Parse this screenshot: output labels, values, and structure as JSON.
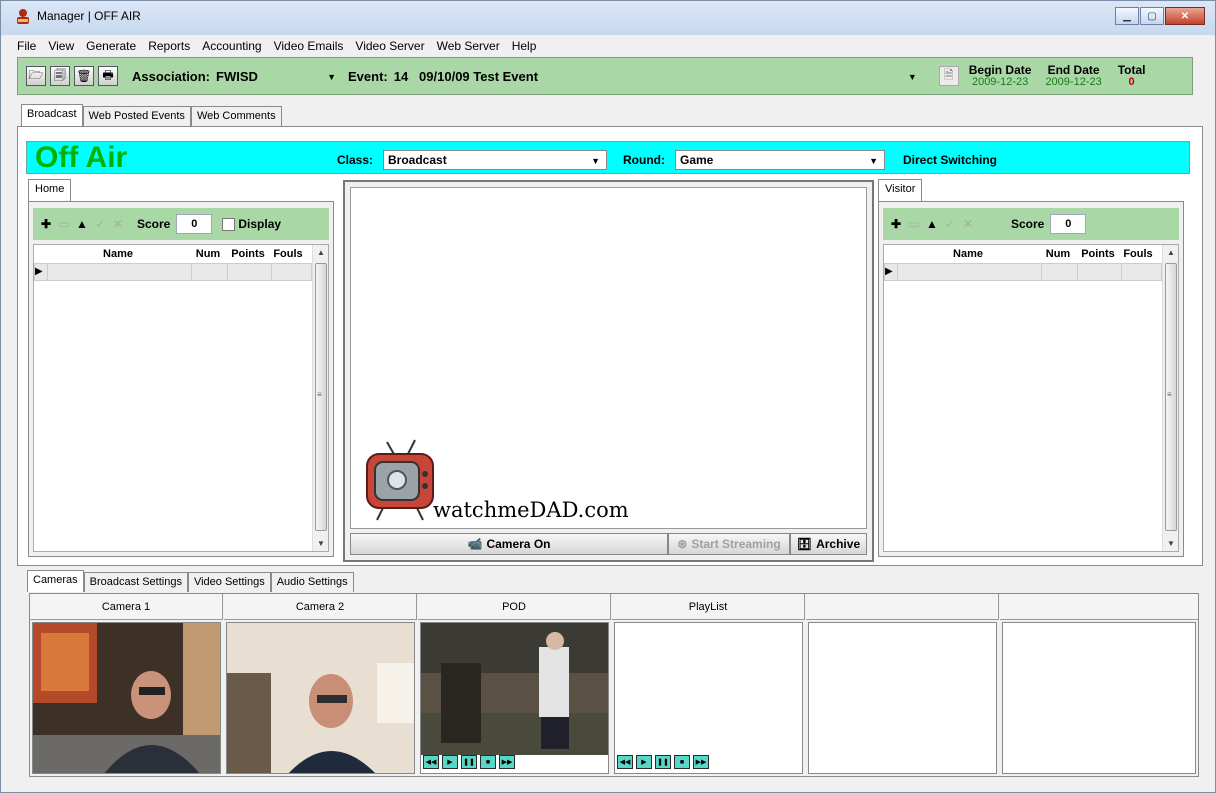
{
  "window": {
    "title": "Manager | OFF AIR",
    "buttons": [
      "minimize",
      "maximize",
      "close"
    ]
  },
  "menu": [
    "File",
    "View",
    "Generate",
    "Reports",
    "Accounting",
    "Video Emails",
    "Video Server",
    "Web Server",
    "Help"
  ],
  "toolbar": {
    "icons": [
      "open-folder-icon",
      "save-icon",
      "delete-icon",
      "print-icon"
    ],
    "association_label": "Association:",
    "association_value": "FWISD",
    "event_label": "Event:",
    "event_value": "14   09/10/09 Test Event",
    "begin_date_label": "Begin Date",
    "begin_date_value": "2009-12-23",
    "end_date_label": "End Date",
    "end_date_value": "2009-12-23",
    "total_label": "Total",
    "total_value": "0"
  },
  "top_tabs": [
    "Broadcast",
    "Web Posted Events",
    "Web Comments"
  ],
  "broadcast": {
    "status": "Off Air",
    "class_label": "Class:",
    "class_value": "Broadcast",
    "round_label": "Round:",
    "round_value": "Game",
    "switching": "Direct Switching",
    "status_color": "#00ffff",
    "status_text_color": "#00b300"
  },
  "home": {
    "tab": "Home",
    "score_label": "Score",
    "score": "0",
    "display_label": "Display",
    "columns": [
      "Name",
      "Num",
      "Points",
      "Fouls"
    ]
  },
  "visitor": {
    "tab": "Visitor",
    "score_label": "Score",
    "score": "0",
    "columns": [
      "Name",
      "Num",
      "Points",
      "Fouls"
    ]
  },
  "video": {
    "logo_text": "watchmeDAD.com",
    "camera_button": "Camera On",
    "stream_button": "Start Streaming",
    "archive_button": "Archive"
  },
  "bottom_tabs": [
    "Cameras",
    "Broadcast Settings",
    "Video Settings",
    "Audio Settings"
  ],
  "cameras": [
    {
      "label": "Camera 1"
    },
    {
      "label": "Camera 2"
    },
    {
      "label": "POD"
    },
    {
      "label": "PlayList"
    },
    {
      "label": ""
    },
    {
      "label": ""
    }
  ]
}
